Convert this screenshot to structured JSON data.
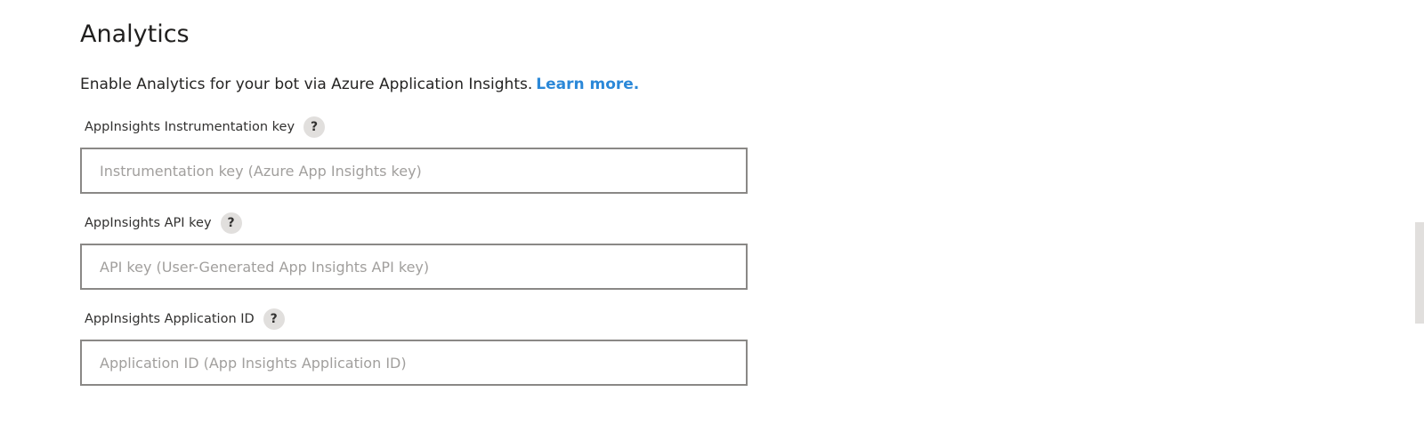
{
  "section": {
    "title": "Analytics",
    "description": "Enable Analytics for your bot via Azure Application Insights.",
    "learn_more": "Learn more."
  },
  "fields": [
    {
      "label": "AppInsights Instrumentation key",
      "help": "?",
      "value": "",
      "placeholder": "Instrumentation key (Azure App Insights key)"
    },
    {
      "label": "AppInsights API key",
      "help": "?",
      "value": "",
      "placeholder": "API key (User-Generated App Insights API key)"
    },
    {
      "label": "AppInsights Application ID",
      "help": "?",
      "value": "",
      "placeholder": "Application ID (App Insights Application ID)"
    }
  ],
  "colors": {
    "link": "#2b88d8",
    "input_border": "#8a8886",
    "placeholder": "#a19f9d",
    "help_bg": "#e1dfdd"
  }
}
